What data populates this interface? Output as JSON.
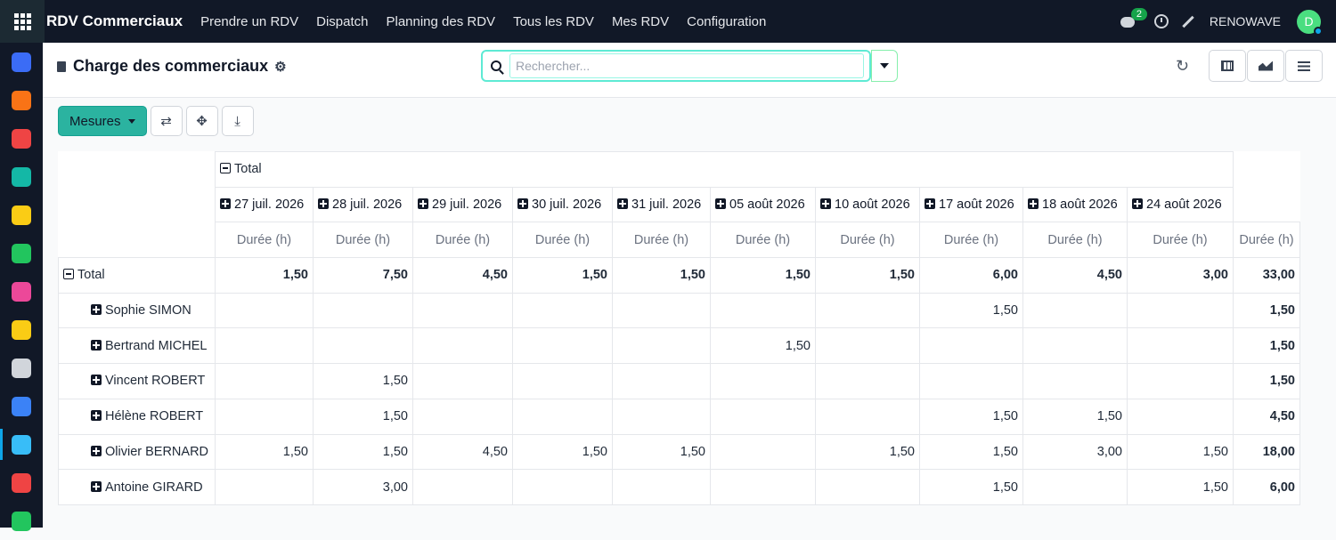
{
  "app": {
    "title": "RDV Commerciaux",
    "menu": [
      "Prendre un RDV",
      "Dispatch",
      "Planning des RDV",
      "Tous les RDV",
      "Mes RDV",
      "Configuration"
    ],
    "message_count": "2",
    "company": "RENOWAVE",
    "user_initial": "D"
  },
  "sidebar": {
    "apps": [
      {
        "icon": "app-blue-icon",
        "color": "#3b6cf6"
      },
      {
        "icon": "app-orange-chat-icon",
        "color": "#f97316"
      },
      {
        "icon": "calendar-31-icon",
        "color": "#ef4444"
      },
      {
        "icon": "sign-icon",
        "color": "#14b8a6"
      },
      {
        "icon": "app-disc-icon",
        "color": "#facc15"
      },
      {
        "icon": "contacts-icon",
        "color": "#22c55e"
      },
      {
        "icon": "discuss-icon",
        "color": "#ec4899"
      },
      {
        "icon": "app-disc-icon-2",
        "color": "#facc15"
      },
      {
        "icon": "bank-icon",
        "color": "#d1d5db"
      },
      {
        "icon": "app-blue-icon-2",
        "color": "#3b82f6"
      },
      {
        "icon": "calendar-icon",
        "color": "#38bdf8"
      },
      {
        "icon": "dashboard-icon",
        "color": "#ef4444"
      },
      {
        "icon": "app-green-icon",
        "color": "#22c55e"
      }
    ],
    "active_index": 10
  },
  "control": {
    "page_title": "Charge des commerciaux",
    "search_placeholder": "Rechercher..."
  },
  "toolbar": {
    "measures_label": "Mesures"
  },
  "pivot": {
    "total_label": "Total",
    "measure_label": "Durée (h)",
    "columns": [
      "27 juil. 2026",
      "28 juil. 2026",
      "29 juil. 2026",
      "30 juil. 2026",
      "31 juil. 2026",
      "05 août 2026",
      "10 août 2026",
      "17 août 2026",
      "18 août 2026",
      "24 août 2026"
    ],
    "total_row": [
      "1,50",
      "7,50",
      "4,50",
      "1,50",
      "1,50",
      "1,50",
      "1,50",
      "6,00",
      "4,50",
      "3,00",
      "33,00"
    ],
    "rows": [
      {
        "name": "Sophie SIMON",
        "values": [
          "",
          "",
          "",
          "",
          "",
          "",
          "",
          "1,50",
          "",
          "",
          "1,50"
        ]
      },
      {
        "name": "Bertrand MICHEL",
        "values": [
          "",
          "",
          "",
          "",
          "",
          "1,50",
          "",
          "",
          "",
          "",
          "1,50"
        ]
      },
      {
        "name": "Vincent ROBERT",
        "values": [
          "",
          "1,50",
          "",
          "",
          "",
          "",
          "",
          "",
          "",
          "",
          "1,50"
        ]
      },
      {
        "name": "Hélène ROBERT",
        "values": [
          "",
          "1,50",
          "",
          "",
          "",
          "",
          "",
          "1,50",
          "1,50",
          "",
          "4,50"
        ]
      },
      {
        "name": "Olivier BERNARD",
        "values": [
          "1,50",
          "1,50",
          "4,50",
          "1,50",
          "1,50",
          "",
          "1,50",
          "1,50",
          "3,00",
          "1,50",
          "18,00"
        ]
      },
      {
        "name": "Antoine GIRARD",
        "values": [
          "",
          "3,00",
          "",
          "",
          "",
          "",
          "",
          "1,50",
          "",
          "1,50",
          "6,00"
        ]
      }
    ]
  }
}
